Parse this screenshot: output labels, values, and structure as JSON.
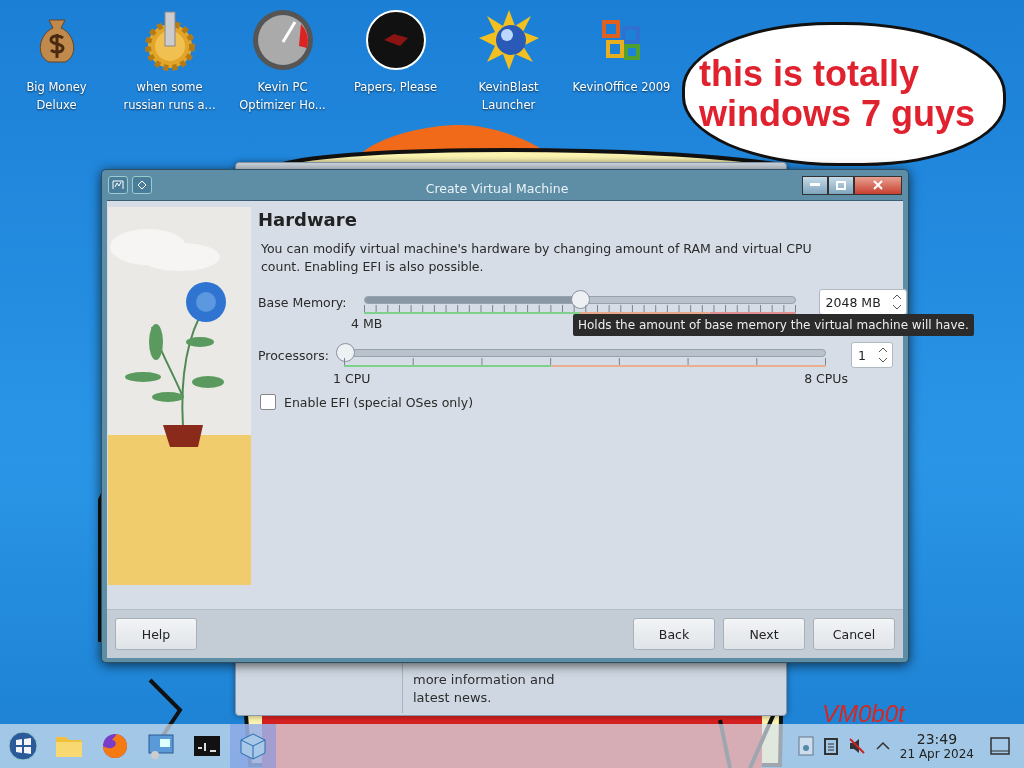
{
  "desktop_icons": [
    {
      "label": "Big Money Deluxe",
      "kind": "money"
    },
    {
      "label": "when some russian runs a...",
      "kind": "gear"
    },
    {
      "label": "Kevin PC Optimizer Ho...",
      "kind": "gauge"
    },
    {
      "label": "Papers, Please",
      "kind": "disc"
    },
    {
      "label": "KevinBlast Launcher",
      "kind": "sun"
    },
    {
      "label": "KevinOffice 2009",
      "kind": "office"
    }
  ],
  "speech_bubble": {
    "text": "this is totally windows 7 guys"
  },
  "background_window": {
    "text": "more information and latest news."
  },
  "dialog": {
    "title": "Create Virtual Machine",
    "heading": "Hardware",
    "description": "You can modify virtual machine's hardware by changing amount of RAM and virtual CPU count. Enabling EFI is also possible.",
    "memory": {
      "label": "Base Memory:",
      "level": 0.5,
      "min_label": "4 MB",
      "value": "2048 MB"
    },
    "tooltip": "Holds the amount of base memory the virtual machine will have.",
    "processors": {
      "label": "Processors:",
      "level": 0,
      "min_label": "1 CPU",
      "max_label": "8 CPUs",
      "value": "1"
    },
    "efi": {
      "label": "Enable EFI (special OSes only)",
      "checked": false
    },
    "buttons": [
      {
        "label": "Help"
      },
      {
        "label": "Back"
      },
      {
        "label": "Next"
      },
      {
        "label": "Cancel"
      }
    ]
  },
  "signature": "VM0b0t",
  "taskbar": {
    "apps": [
      {
        "kind": "folder",
        "selected": false
      },
      {
        "kind": "browser",
        "selected": false
      },
      {
        "kind": "remote",
        "selected": false
      },
      {
        "kind": "terminal",
        "selected": false
      },
      {
        "kind": "vbox",
        "selected": true
      }
    ],
    "time": "23:49",
    "date": "21 Apr 2024"
  }
}
